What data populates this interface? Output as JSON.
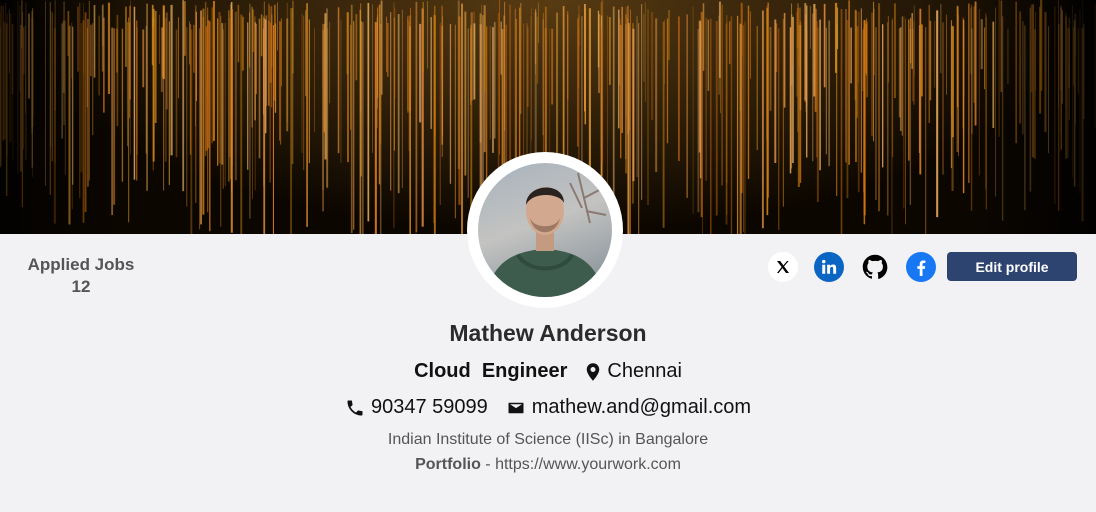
{
  "profile": {
    "name": "Mathew Anderson",
    "role": "Cloud  Engineer",
    "location": "Chennai",
    "phone": "90347 59099",
    "email": "mathew.and@gmail.com",
    "institute": "Indian Institute of Science (IISc) in Bangalore",
    "portfolio_label": "Portfolio",
    "portfolio_separator": " - ",
    "portfolio_url": "https://www.yourwork.com"
  },
  "stats": {
    "applied_jobs_label": "Applied Jobs",
    "applied_jobs_count": "12"
  },
  "actions": {
    "edit_profile_label": "Edit profile"
  },
  "socials": [
    {
      "name": "x-icon",
      "color": "#000000"
    },
    {
      "name": "linkedin-icon",
      "color": "#0a66c2"
    },
    {
      "name": "github-icon",
      "color": "#000000"
    },
    {
      "name": "facebook-icon",
      "color": "#1877f2"
    }
  ],
  "colors": {
    "page_background": "#f2f2f5",
    "primary_button": "#2e4470",
    "banner_glow": "#f0a030"
  }
}
